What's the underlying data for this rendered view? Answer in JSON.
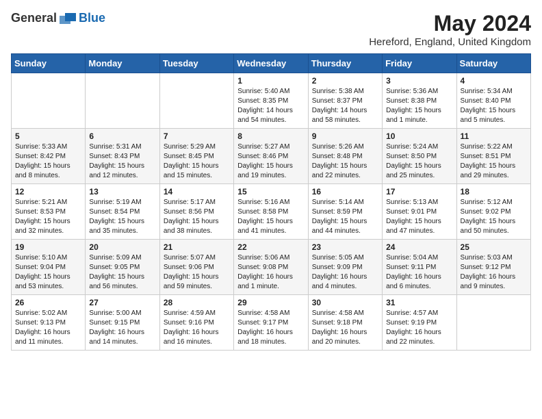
{
  "header": {
    "logo_general": "General",
    "logo_blue": "Blue",
    "month_title": "May 2024",
    "location": "Hereford, England, United Kingdom"
  },
  "days_of_week": [
    "Sunday",
    "Monday",
    "Tuesday",
    "Wednesday",
    "Thursday",
    "Friday",
    "Saturday"
  ],
  "weeks": [
    [
      {
        "day": "",
        "info": ""
      },
      {
        "day": "",
        "info": ""
      },
      {
        "day": "",
        "info": ""
      },
      {
        "day": "1",
        "info": "Sunrise: 5:40 AM\nSunset: 8:35 PM\nDaylight: 14 hours\nand 54 minutes."
      },
      {
        "day": "2",
        "info": "Sunrise: 5:38 AM\nSunset: 8:37 PM\nDaylight: 14 hours\nand 58 minutes."
      },
      {
        "day": "3",
        "info": "Sunrise: 5:36 AM\nSunset: 8:38 PM\nDaylight: 15 hours\nand 1 minute."
      },
      {
        "day": "4",
        "info": "Sunrise: 5:34 AM\nSunset: 8:40 PM\nDaylight: 15 hours\nand 5 minutes."
      }
    ],
    [
      {
        "day": "5",
        "info": "Sunrise: 5:33 AM\nSunset: 8:42 PM\nDaylight: 15 hours\nand 8 minutes."
      },
      {
        "day": "6",
        "info": "Sunrise: 5:31 AM\nSunset: 8:43 PM\nDaylight: 15 hours\nand 12 minutes."
      },
      {
        "day": "7",
        "info": "Sunrise: 5:29 AM\nSunset: 8:45 PM\nDaylight: 15 hours\nand 15 minutes."
      },
      {
        "day": "8",
        "info": "Sunrise: 5:27 AM\nSunset: 8:46 PM\nDaylight: 15 hours\nand 19 minutes."
      },
      {
        "day": "9",
        "info": "Sunrise: 5:26 AM\nSunset: 8:48 PM\nDaylight: 15 hours\nand 22 minutes."
      },
      {
        "day": "10",
        "info": "Sunrise: 5:24 AM\nSunset: 8:50 PM\nDaylight: 15 hours\nand 25 minutes."
      },
      {
        "day": "11",
        "info": "Sunrise: 5:22 AM\nSunset: 8:51 PM\nDaylight: 15 hours\nand 29 minutes."
      }
    ],
    [
      {
        "day": "12",
        "info": "Sunrise: 5:21 AM\nSunset: 8:53 PM\nDaylight: 15 hours\nand 32 minutes."
      },
      {
        "day": "13",
        "info": "Sunrise: 5:19 AM\nSunset: 8:54 PM\nDaylight: 15 hours\nand 35 minutes."
      },
      {
        "day": "14",
        "info": "Sunrise: 5:17 AM\nSunset: 8:56 PM\nDaylight: 15 hours\nand 38 minutes."
      },
      {
        "day": "15",
        "info": "Sunrise: 5:16 AM\nSunset: 8:58 PM\nDaylight: 15 hours\nand 41 minutes."
      },
      {
        "day": "16",
        "info": "Sunrise: 5:14 AM\nSunset: 8:59 PM\nDaylight: 15 hours\nand 44 minutes."
      },
      {
        "day": "17",
        "info": "Sunrise: 5:13 AM\nSunset: 9:01 PM\nDaylight: 15 hours\nand 47 minutes."
      },
      {
        "day": "18",
        "info": "Sunrise: 5:12 AM\nSunset: 9:02 PM\nDaylight: 15 hours\nand 50 minutes."
      }
    ],
    [
      {
        "day": "19",
        "info": "Sunrise: 5:10 AM\nSunset: 9:04 PM\nDaylight: 15 hours\nand 53 minutes."
      },
      {
        "day": "20",
        "info": "Sunrise: 5:09 AM\nSunset: 9:05 PM\nDaylight: 15 hours\nand 56 minutes."
      },
      {
        "day": "21",
        "info": "Sunrise: 5:07 AM\nSunset: 9:06 PM\nDaylight: 15 hours\nand 59 minutes."
      },
      {
        "day": "22",
        "info": "Sunrise: 5:06 AM\nSunset: 9:08 PM\nDaylight: 16 hours\nand 1 minute."
      },
      {
        "day": "23",
        "info": "Sunrise: 5:05 AM\nSunset: 9:09 PM\nDaylight: 16 hours\nand 4 minutes."
      },
      {
        "day": "24",
        "info": "Sunrise: 5:04 AM\nSunset: 9:11 PM\nDaylight: 16 hours\nand 6 minutes."
      },
      {
        "day": "25",
        "info": "Sunrise: 5:03 AM\nSunset: 9:12 PM\nDaylight: 16 hours\nand 9 minutes."
      }
    ],
    [
      {
        "day": "26",
        "info": "Sunrise: 5:02 AM\nSunset: 9:13 PM\nDaylight: 16 hours\nand 11 minutes."
      },
      {
        "day": "27",
        "info": "Sunrise: 5:00 AM\nSunset: 9:15 PM\nDaylight: 16 hours\nand 14 minutes."
      },
      {
        "day": "28",
        "info": "Sunrise: 4:59 AM\nSunset: 9:16 PM\nDaylight: 16 hours\nand 16 minutes."
      },
      {
        "day": "29",
        "info": "Sunrise: 4:58 AM\nSunset: 9:17 PM\nDaylight: 16 hours\nand 18 minutes."
      },
      {
        "day": "30",
        "info": "Sunrise: 4:58 AM\nSunset: 9:18 PM\nDaylight: 16 hours\nand 20 minutes."
      },
      {
        "day": "31",
        "info": "Sunrise: 4:57 AM\nSunset: 9:19 PM\nDaylight: 16 hours\nand 22 minutes."
      },
      {
        "day": "",
        "info": ""
      }
    ]
  ]
}
